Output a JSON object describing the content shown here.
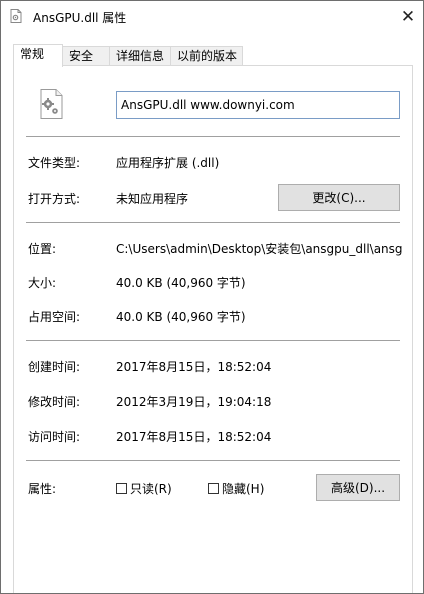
{
  "window": {
    "title": "AnsGPU.dll 属性",
    "close_glyph": "✕"
  },
  "tabs": [
    {
      "label": "常规",
      "active": true
    },
    {
      "label": "安全",
      "active": false
    },
    {
      "label": "详细信息",
      "active": false
    },
    {
      "label": "以前的版本",
      "active": false
    }
  ],
  "general": {
    "file_name": "AnsGPU.dll www.downyi.com",
    "file_type_label": "文件类型:",
    "file_type_value": "应用程序扩展 (.dll)",
    "open_with_label": "打开方式:",
    "open_with_value": "未知应用程序",
    "change_button": "更改(C)...",
    "location_label": "位置:",
    "location_value": "C:\\Users\\admin\\Desktop\\安装包\\ansgpu_dll\\ansg",
    "size_label": "大小:",
    "size_value": "40.0 KB (40,960 字节)",
    "size_on_disk_label": "占用空间:",
    "size_on_disk_value": "40.0 KB (40,960 字节)",
    "created_label": "创建时间:",
    "created_value": "2017年8月15日，18:52:04",
    "modified_label": "修改时间:",
    "modified_value": "2012年3月19日，19:04:18",
    "accessed_label": "访问时间:",
    "accessed_value": "2017年8月15日，18:52:04",
    "attributes_label": "属性:",
    "readonly_label": "只读(R)",
    "readonly_checked": false,
    "hidden_label": "隐藏(H)",
    "hidden_checked": false,
    "advanced_button": "高级(D)..."
  },
  "icons": {
    "title": "dll-file-icon",
    "file": "dll-gear-file-icon"
  },
  "colors": {
    "border": "#6e6e6e",
    "button_bg": "#e1e1e1",
    "field_border": "#7a9cc6"
  }
}
